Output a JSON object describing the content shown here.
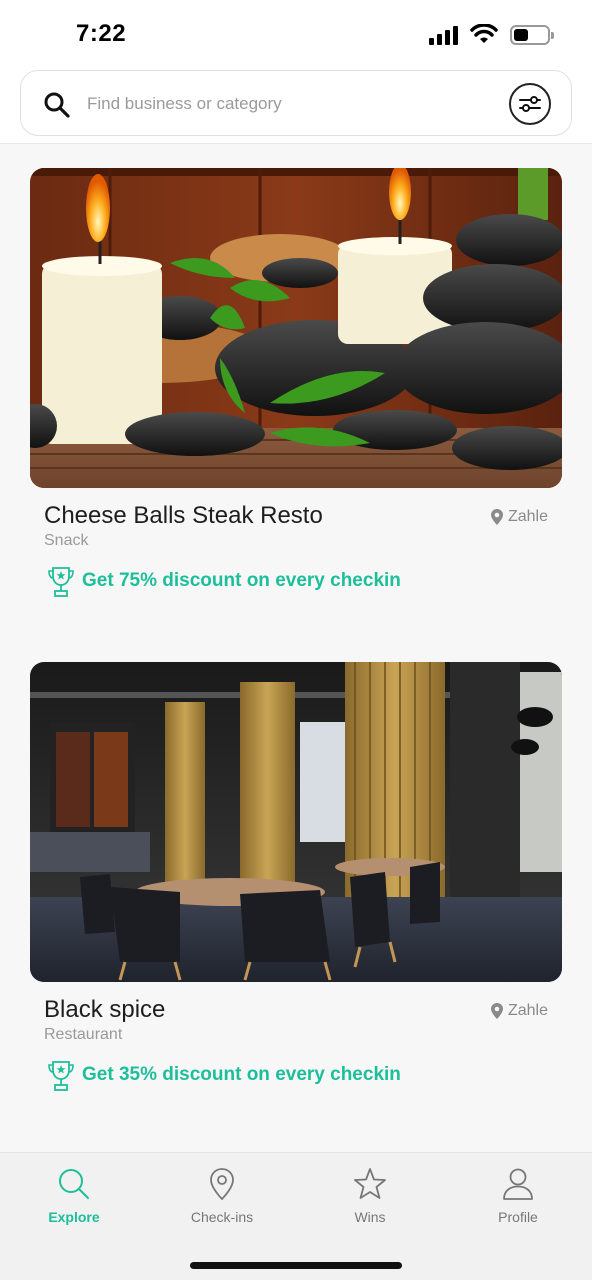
{
  "status": {
    "time": "7:22",
    "battery_level": 0.45
  },
  "search": {
    "placeholder": "Find business or category",
    "value": ""
  },
  "cards": [
    {
      "title": "Cheese Balls Steak Resto",
      "category": "Snack",
      "location": "Zahle",
      "offer": "Get 75% discount on every checkin",
      "image": "spa-stones-candles-image"
    },
    {
      "title": "Black spice",
      "category": "Restaurant",
      "location": "Zahle",
      "offer": "Get 35% discount on every checkin",
      "image": "restaurant-interior-image"
    }
  ],
  "nav": [
    {
      "label": "Explore",
      "icon": "search-icon",
      "active": true
    },
    {
      "label": "Check-ins",
      "icon": "location-pin-icon",
      "active": false
    },
    {
      "label": "Wins",
      "icon": "star-icon",
      "active": false
    },
    {
      "label": "Profile",
      "icon": "user-icon",
      "active": false
    }
  ],
  "colors": {
    "accent": "#1dbf9a",
    "background": "#f7f7f7",
    "nav_background": "#f1f1f1"
  }
}
